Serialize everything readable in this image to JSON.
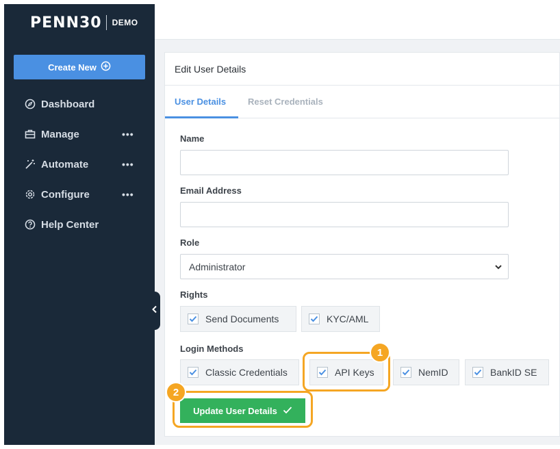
{
  "brand": {
    "logo": "PENN30",
    "env": "DEMO"
  },
  "sidebar": {
    "create_label": "Create New",
    "items": [
      {
        "label": "Dashboard",
        "icon": "compass-icon"
      },
      {
        "label": "Manage",
        "icon": "briefcase-icon",
        "more": "•••"
      },
      {
        "label": "Automate",
        "icon": "magic-wand-icon",
        "more": "•••"
      },
      {
        "label": "Configure",
        "icon": "gear-icon",
        "more": "•••"
      },
      {
        "label": "Help Center",
        "icon": "question-circle-icon"
      }
    ]
  },
  "panel": {
    "title": "Edit User Details",
    "tabs": [
      {
        "label": "User Details",
        "active": true
      },
      {
        "label": "Reset Credentials",
        "active": false
      }
    ]
  },
  "form": {
    "name_label": "Name",
    "name_value": "",
    "email_label": "Email Address",
    "email_value": "",
    "role_label": "Role",
    "role_value": "Administrator",
    "rights_label": "Rights",
    "rights": [
      {
        "label": "Send Documents",
        "checked": true
      },
      {
        "label": "KYC/AML",
        "checked": true
      }
    ],
    "login_label": "Login Methods",
    "login": [
      {
        "label": "Classic Credentials",
        "checked": true
      },
      {
        "label": "API Keys",
        "checked": true
      },
      {
        "label": "NemID",
        "checked": true
      },
      {
        "label": "BankID SE",
        "checked": true
      }
    ],
    "submit_label": "Update User Details"
  },
  "annotations": [
    {
      "number": "1"
    },
    {
      "number": "2"
    }
  ],
  "colors": {
    "sidebar": "#1a2939",
    "primary": "#4a90e2",
    "success": "#33b15c",
    "highlight": "#f5a623"
  }
}
